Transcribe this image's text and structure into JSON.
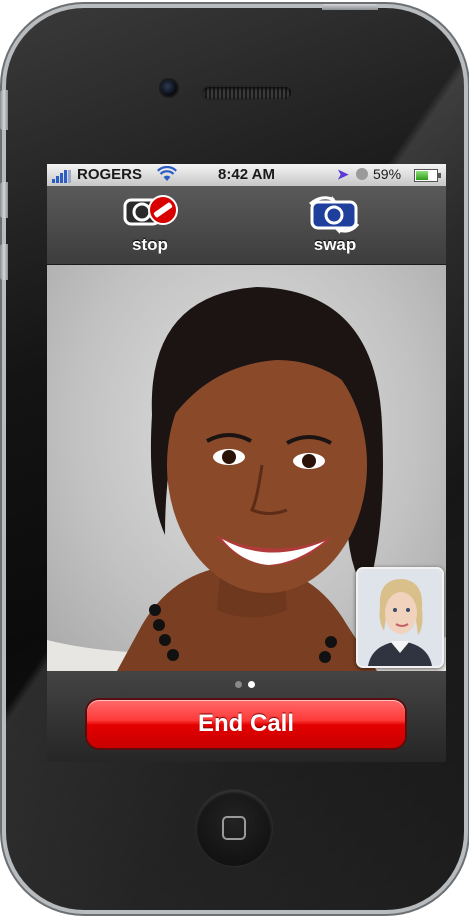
{
  "status_bar": {
    "carrier": "ROGERS",
    "time": "8:42 AM",
    "battery_percent": "59%",
    "icons": [
      "signal-icon",
      "wifi-icon",
      "location-icon",
      "clock-icon",
      "battery-icon"
    ]
  },
  "toolbar": {
    "stop_label": "stop",
    "swap_label": "swap"
  },
  "call": {
    "end_label": "End Call",
    "page_count": 2,
    "active_page": 2
  },
  "colors": {
    "end_call_red": "#e30000",
    "toolbar_gray": "#4a4a4a",
    "status_bar": "#dcdcdc"
  }
}
